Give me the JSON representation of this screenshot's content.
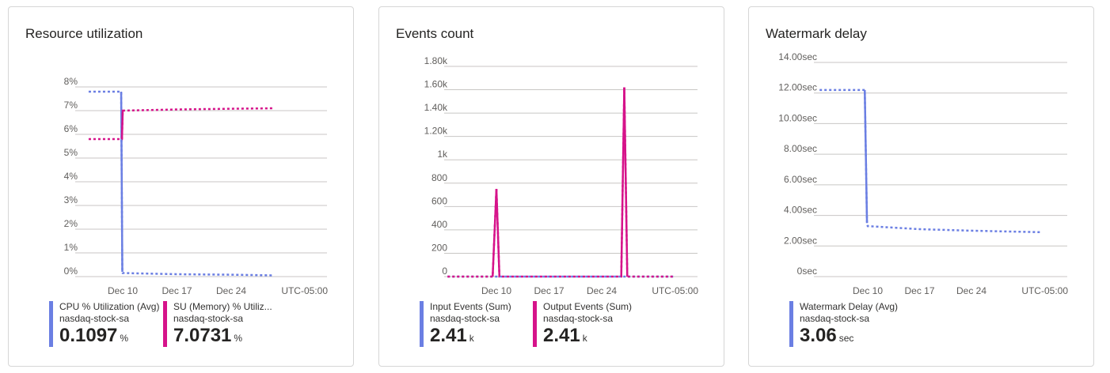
{
  "colors": {
    "blue": "#6b7fe3",
    "magenta": "#d6138a",
    "grid": "#c8c6c4"
  },
  "cards": [
    {
      "title": "Resource utilization",
      "legend": [
        {
          "name": "CPU % Utilization (Avg)",
          "resource": "nasdaq-stock-sa",
          "value": "0.1097",
          "unit": "%",
          "color": "#6b7fe3"
        },
        {
          "name": "SU (Memory) % Utiliz...",
          "resource": "nasdaq-stock-sa",
          "value": "7.0731",
          "unit": "%",
          "color": "#d6138a"
        }
      ]
    },
    {
      "title": "Events count",
      "legend": [
        {
          "name": "Input Events (Sum)",
          "resource": "nasdaq-stock-sa",
          "value": "2.41",
          "unit": "k",
          "color": "#6b7fe3"
        },
        {
          "name": "Output Events (Sum)",
          "resource": "nasdaq-stock-sa",
          "value": "2.41",
          "unit": "k",
          "color": "#d6138a"
        }
      ]
    },
    {
      "title": "Watermark delay",
      "legend": [
        {
          "name": "Watermark Delay (Avg)",
          "resource": "nasdaq-stock-sa",
          "value": "3.06",
          "unit": "sec",
          "color": "#6b7fe3"
        }
      ]
    }
  ],
  "chart_data": [
    {
      "type": "line",
      "title": "Resource utilization",
      "yticks": [
        "0%",
        "1%",
        "2%",
        "3%",
        "4%",
        "5%",
        "6%",
        "7%",
        "8%"
      ],
      "ylim": [
        0,
        8
      ],
      "xticks": [
        "Dec 10",
        "Dec 17",
        "Dec 24"
      ],
      "timezone": "UTC-05:00",
      "x_days": [
        0,
        7,
        14
      ],
      "x_range_days": [
        -4.4,
        19.5
      ],
      "series": [
        {
          "name": "CPU % Utilization (Avg)",
          "color": "#6b7fe3",
          "x": [
            -4.4,
            -1.3,
            -0.2,
            -0.05,
            0.0,
            7,
            14,
            19.5
          ],
          "y": [
            7.8,
            7.8,
            7.8,
            0.2,
            0.15,
            0.1,
            0.08,
            0.05
          ],
          "solid_until": -1
        },
        {
          "name": "SU (Memory) % Utiliz...",
          "color": "#d6138a",
          "x": [
            -4.4,
            -1.3,
            -0.1,
            0.0,
            7,
            14,
            19.5
          ],
          "y": [
            5.8,
            5.8,
            5.8,
            7.0,
            7.05,
            7.08,
            7.1
          ]
        }
      ]
    },
    {
      "type": "line",
      "title": "Events count",
      "yticks": [
        "0",
        "200",
        "400",
        "600",
        "800",
        "1k",
        "1.20k",
        "1.40k",
        "1.60k",
        "1.80k"
      ],
      "ylim": [
        0,
        1800
      ],
      "xticks": [
        "Dec 10",
        "Dec 17",
        "Dec 24"
      ],
      "timezone": "UTC-05:00",
      "x_days": [
        0,
        7,
        14
      ],
      "x_range_days": [
        -6.5,
        23.5
      ],
      "series": [
        {
          "name": "Input Events (Sum)",
          "color": "#6b7fe3",
          "x": [
            -6.5,
            23.5
          ],
          "y": [
            0,
            0
          ]
        },
        {
          "name": "Output Events (Sum)",
          "color": "#d6138a",
          "x": [
            -6.5,
            -0.5,
            0,
            0.4,
            16.6,
            17.0,
            17.4,
            23.5
          ],
          "y": [
            0,
            0,
            750,
            0,
            0,
            1620,
            0,
            0
          ]
        }
      ]
    },
    {
      "type": "line",
      "title": "Watermark delay",
      "yticks": [
        "0sec",
        "2.00sec",
        "4.00sec",
        "6.00sec",
        "8.00sec",
        "10.00sec",
        "12.00sec",
        "14.00sec"
      ],
      "ylim": [
        0,
        14
      ],
      "xticks": [
        "Dec 10",
        "Dec 17",
        "Dec 24"
      ],
      "timezone": "UTC-05:00",
      "x_days": [
        0,
        7,
        14
      ],
      "x_range_days": [
        -6.5,
        23.5
      ],
      "series": [
        {
          "name": "Watermark Delay (Avg)",
          "color": "#6b7fe3",
          "x": [
            -6.5,
            -0.5,
            -0.4,
            -0.1,
            0.0,
            7,
            14,
            23.5
          ],
          "y": [
            12.2,
            12.2,
            12.2,
            3.5,
            3.3,
            3.1,
            3.0,
            2.9
          ]
        }
      ]
    }
  ]
}
